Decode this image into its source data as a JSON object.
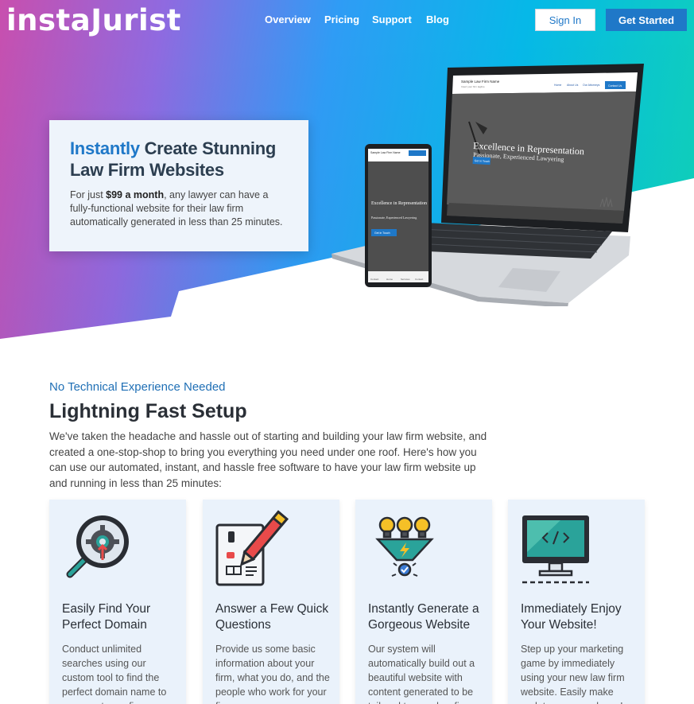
{
  "nav": {
    "logo": "instaJurist",
    "links": [
      "Overview",
      "Pricing",
      "Support",
      "Blog"
    ],
    "sign_in": "Sign In",
    "get_started": "Get Started"
  },
  "hero": {
    "title_accent": "Instantly",
    "title_rest": " Create Stunning Law Firm Websites",
    "text_prefix": "For just ",
    "text_bold": "$99 a month",
    "text_suffix": ", any lawyer can have a fully-functional website for their law firm automatically generated in less than 25 minutes."
  },
  "mockup": {
    "laptop_site_name": "Sample Law Firm Name",
    "laptop_site_tagline": "Insert your firm tagline",
    "laptop_nav": [
      "Home",
      "About Us",
      "Our Attorneys"
    ],
    "laptop_cta": "Contact Us",
    "laptop_heading": "Excellence in Representation",
    "laptop_subheading": "Passionate, Experienced Lawyering",
    "laptop_button": "Get in Touch",
    "phone_site_name": "Sample Law Firm Name",
    "phone_heading": "Excellence in Representation",
    "phone_subheading": "Passionate, Experienced Lawyering",
    "phone_button": "Get in Touch",
    "phone_tabs": [
      "Contact",
      "Home",
      "Services",
      "Contact"
    ]
  },
  "section": {
    "eyebrow": "No Technical Experience Needed",
    "title": "Lightning Fast Setup",
    "text": "We've taken the headache and hassle out of starting and building your law firm website, and created a one-stop-shop to bring you everything you need under one roof. Here's how you can use our automated, instant, and hassle free software to have your law firm website up and running in less than 25 minutes:"
  },
  "cards": [
    {
      "icon": "domain-search-icon",
      "title": "Easily Find Your Perfect Domain",
      "text": "Conduct unlimited searches using our custom tool to find the perfect domain name to represent your firm."
    },
    {
      "icon": "questionnaire-icon",
      "title": "Answer a Few Quick Questions",
      "text": "Provide us some basic information about your firm, what you do, and the people who work for your firm."
    },
    {
      "icon": "website-generator-icon",
      "title": "Instantly Generate a Gorgeous Website",
      "text": "Our system will automatically build out a beautiful website with content generated to be tailored to your law firm."
    },
    {
      "icon": "monitor-icon",
      "title": "Immediately Enjoy Your Website!",
      "text": "Step up your marketing game by immediately using your new law firm website. Easily make updates as you please!"
    }
  ],
  "colors": {
    "brand_blue": "#1f78c8",
    "card_bg": "#eaf2fb",
    "icon_teal": "#2aa39a",
    "icon_yellow": "#f5c027",
    "icon_red": "#e84a4a"
  }
}
